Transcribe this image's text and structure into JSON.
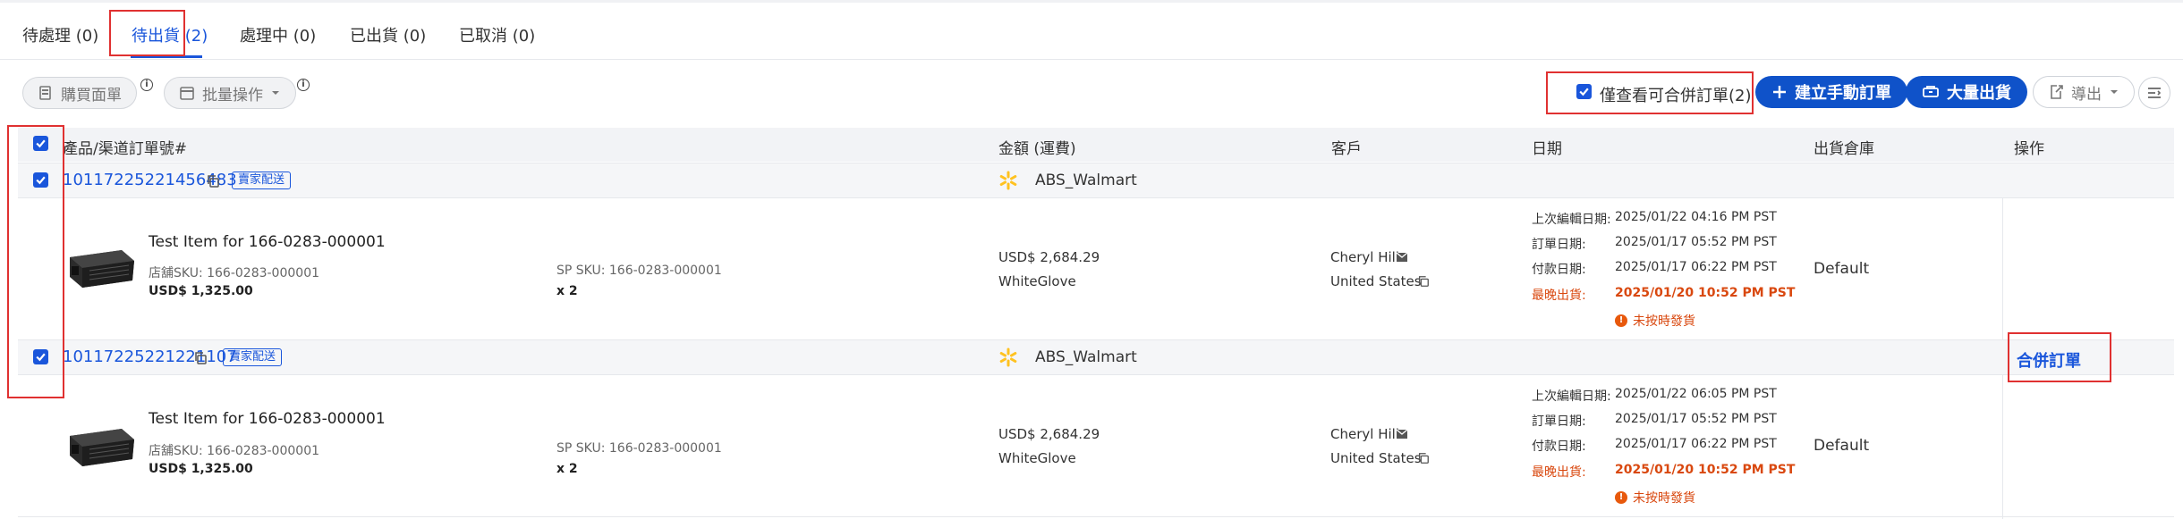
{
  "tabs": [
    {
      "label": "待處理 (0)"
    },
    {
      "label": "待出貨 (2)"
    },
    {
      "label": "處理中 (0)"
    },
    {
      "label": "已出貨 (0)"
    },
    {
      "label": "已取消 (0)"
    }
  ],
  "toolbar": {
    "purchase_slip": "購買面單",
    "batch_ops": "批量操作",
    "merge_filter_label": "僅查看可合併訂單(2)",
    "merge_filter_checked": true,
    "create_manual_order": "建立手動訂單",
    "bulk_ship": "大量出貨",
    "export": "導出"
  },
  "table": {
    "headers": {
      "product": "產品/渠道訂單號#",
      "amount": "金額 (運費)",
      "customer": "客戶",
      "date": "日期",
      "warehouse": "出貨倉庫",
      "actions": "操作"
    },
    "orders": [
      {
        "order_no": "10117225221456483",
        "badge": "賣家配送",
        "store": "ABS_Walmart",
        "item_title": "Test Item for 166-0283-000001",
        "store_sku": "店舖SKU: 166-0283-000001",
        "item_price": "USD$ 1,325.00",
        "sp_sku": "SP SKU: 166-0283-000001",
        "qty": "x 2",
        "amount": "USD$ 2,684.29",
        "shipping": "WhiteGlove",
        "customer": "Cheryl Hill",
        "country": "United States",
        "dates": [
          {
            "label": "上次編輯日期:",
            "value": "2025/01/22 04:16 PM PST"
          },
          {
            "label": "訂單日期:",
            "value": "2025/01/17 05:52 PM PST"
          },
          {
            "label": "付款日期:",
            "value": "2025/01/17 06:22 PM PST"
          }
        ],
        "latest_ship_label": "最晚出貨:",
        "latest_ship_value": "2025/01/20 10:52 PM PST",
        "late_warning": "未按時發貨",
        "warehouse": "Default"
      },
      {
        "order_no": "10117225221221107",
        "badge": "賣家配送",
        "store": "ABS_Walmart",
        "item_title": "Test Item for 166-0283-000001",
        "store_sku": "店舖SKU: 166-0283-000001",
        "item_price": "USD$ 1,325.00",
        "sp_sku": "SP SKU: 166-0283-000001",
        "qty": "x 2",
        "amount": "USD$ 2,684.29",
        "shipping": "WhiteGlove",
        "customer": "Cheryl Hill",
        "country": "United States",
        "dates": [
          {
            "label": "上次編輯日期:",
            "value": "2025/01/22 06:05 PM PST"
          },
          {
            "label": "訂單日期:",
            "value": "2025/01/17 05:52 PM PST"
          },
          {
            "label": "付款日期:",
            "value": "2025/01/17 06:22 PM PST"
          }
        ],
        "latest_ship_label": "最晚出貨:",
        "latest_ship_value": "2025/01/20 10:52 PM PST",
        "late_warning": "未按時發貨",
        "warehouse": "Default"
      }
    ],
    "merge_action": "合併訂單"
  },
  "colors": {
    "primary": "#1a56db",
    "button_blue": "#0f52c9",
    "highlight_red": "#e03131",
    "warning_orange": "#d9480f",
    "walmart_yellow": "#ffc220"
  }
}
